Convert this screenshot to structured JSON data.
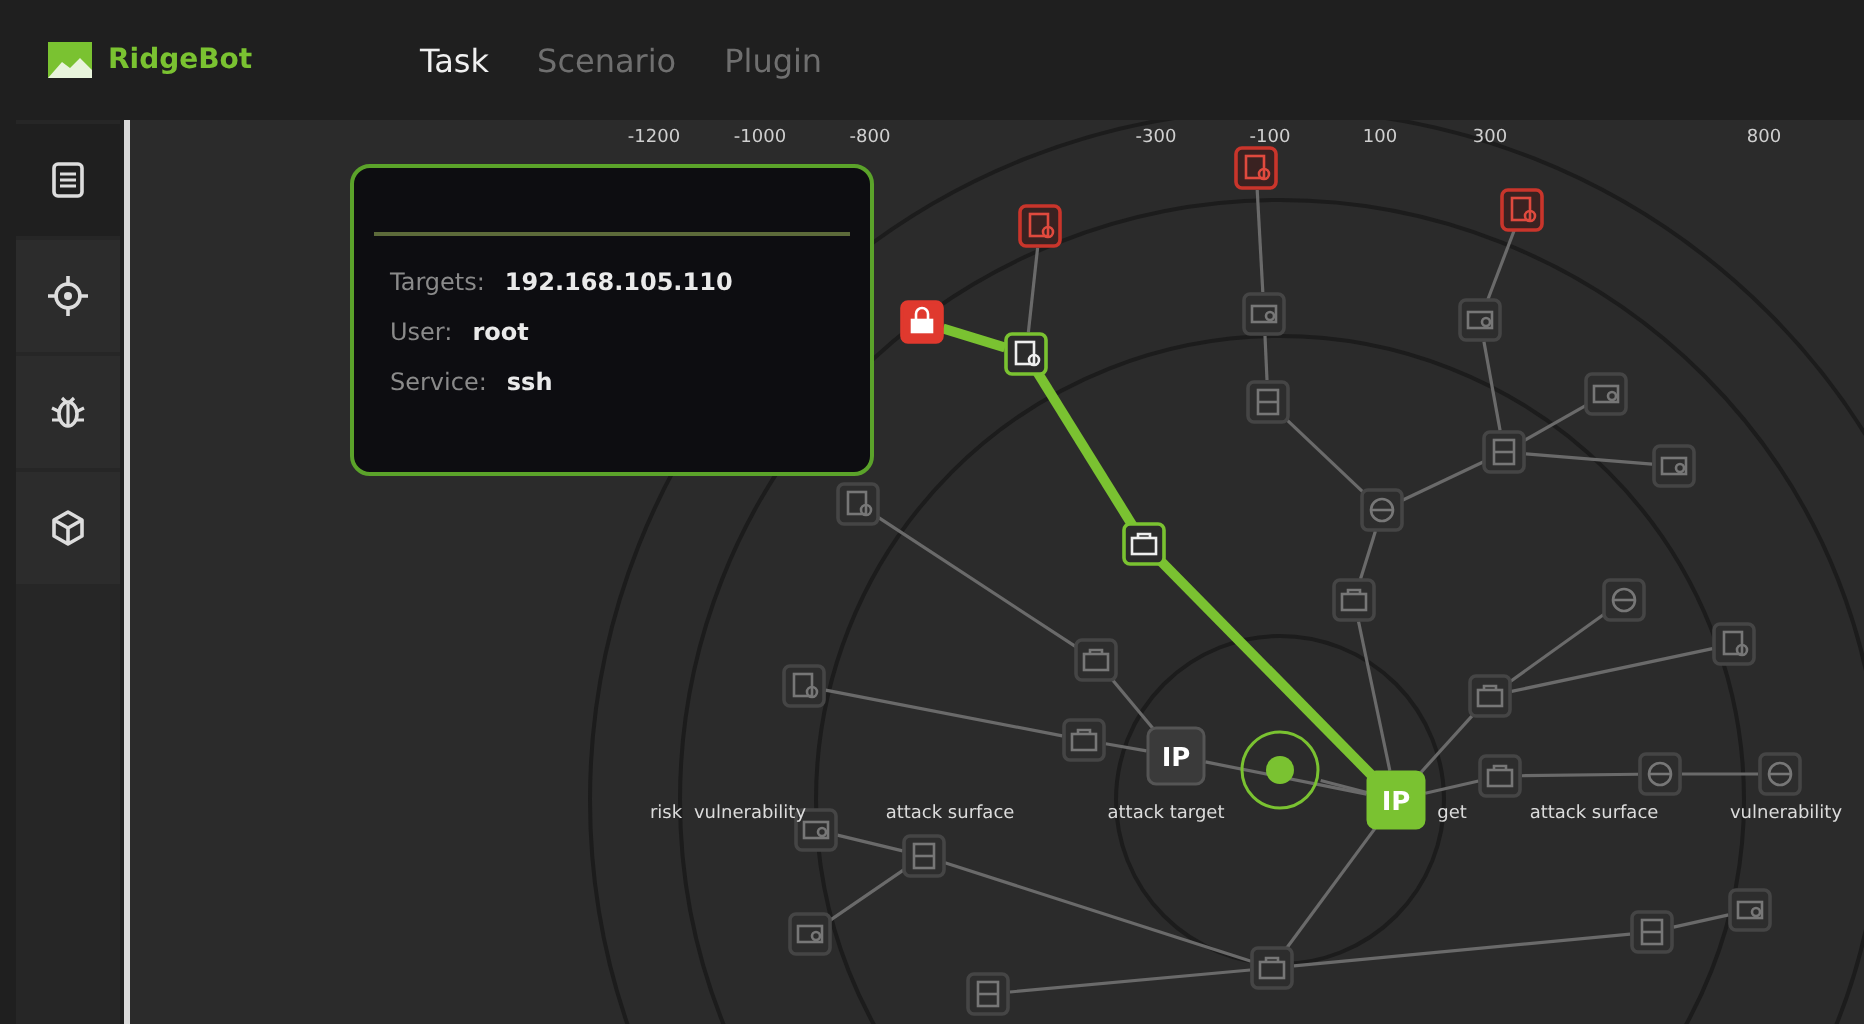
{
  "header": {
    "brand": "RidgeBot"
  },
  "tabs": [
    {
      "label": "Task",
      "selected": true
    },
    {
      "label": "Scenario",
      "selected": false
    },
    {
      "label": "Plugin",
      "selected": false
    }
  ],
  "sidebar": {
    "items": [
      {
        "kind": "list",
        "selected": true
      },
      {
        "kind": "target",
        "selected": false
      },
      {
        "kind": "bug",
        "selected": false
      },
      {
        "kind": "cube",
        "selected": false
      }
    ]
  },
  "graph": {
    "axis_labels": [
      "-1200",
      "-1000",
      "-800",
      "-300",
      "-100",
      "100",
      "300",
      "800"
    ],
    "ring_labels": [
      "risk",
      "vulnerability",
      "attack surface",
      "attack target",
      "get",
      "attack surface",
      "vulnerability"
    ],
    "nodes": [
      {
        "kind": "doc",
        "alert": true,
        "on_path": false
      },
      {
        "kind": "doc",
        "alert": true,
        "on_path": false
      },
      {
        "kind": "doc",
        "alert": true,
        "on_path": false
      },
      {
        "kind": "lock",
        "alert": true,
        "on_path": true
      },
      {
        "kind": "doc",
        "alert": false,
        "on_path": true
      },
      {
        "kind": "briefcase",
        "alert": false,
        "on_path": true
      },
      {
        "kind": "ip",
        "alert": false,
        "on_path": true,
        "label": "IP"
      },
      {
        "kind": "ip",
        "alert": false,
        "on_path": false,
        "label": "IP"
      },
      {
        "kind": "target",
        "alert": false,
        "on_path": true
      },
      {
        "kind": "card",
        "alert": false,
        "on_path": false
      },
      {
        "kind": "server",
        "alert": false,
        "on_path": false
      },
      {
        "kind": "card",
        "alert": false,
        "on_path": false
      },
      {
        "kind": "card",
        "alert": false,
        "on_path": false
      },
      {
        "kind": "server",
        "alert": false,
        "on_path": false
      },
      {
        "kind": "card",
        "alert": false,
        "on_path": false
      },
      {
        "kind": "globe",
        "alert": false,
        "on_path": false
      },
      {
        "kind": "briefcase",
        "alert": false,
        "on_path": false
      },
      {
        "kind": "globe",
        "alert": false,
        "on_path": false
      },
      {
        "kind": "doc",
        "alert": false,
        "on_path": false
      },
      {
        "kind": "briefcase",
        "alert": false,
        "on_path": false
      },
      {
        "kind": "briefcase",
        "alert": false,
        "on_path": false
      },
      {
        "kind": "globe",
        "alert": false,
        "on_path": false
      },
      {
        "kind": "globe",
        "alert": false,
        "on_path": false
      },
      {
        "kind": "briefcase",
        "alert": false,
        "on_path": false
      },
      {
        "kind": "briefcase",
        "alert": false,
        "on_path": false
      },
      {
        "kind": "doc",
        "alert": false,
        "on_path": false
      },
      {
        "kind": "doc",
        "alert": false,
        "on_path": false
      },
      {
        "kind": "card",
        "alert": false,
        "on_path": false
      },
      {
        "kind": "server",
        "alert": false,
        "on_path": false
      },
      {
        "kind": "card",
        "alert": false,
        "on_path": false
      },
      {
        "kind": "briefcase",
        "alert": false,
        "on_path": false
      },
      {
        "kind": "server",
        "alert": false,
        "on_path": false
      },
      {
        "kind": "server",
        "alert": false,
        "on_path": false
      },
      {
        "kind": "card",
        "alert": false,
        "on_path": false
      }
    ]
  },
  "tooltip": {
    "rows": [
      {
        "label": "Targets:",
        "value": "192.168.105.110"
      },
      {
        "label": "User:",
        "value": "root"
      },
      {
        "label": "Service:",
        "value": "ssh"
      }
    ]
  }
}
